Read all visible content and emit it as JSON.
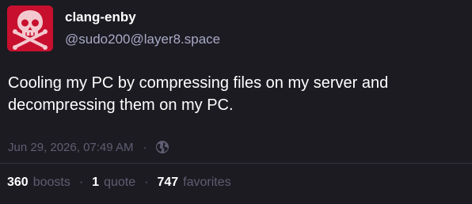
{
  "author": {
    "display_name": "clang-enby",
    "handle": "@sudo200@layer8.space",
    "avatar_icon": "skull-and-crossbones-icon",
    "avatar_color": "#c8102e"
  },
  "post": {
    "content": "Cooling my PC by compressing files on my server and decompressing them on my PC."
  },
  "meta": {
    "timestamp": "Jun 29, 2026, 07:49 AM",
    "separator": "·",
    "visibility_icon": "globe-icon"
  },
  "stats": {
    "boosts_count": "360",
    "boosts_label": "boosts",
    "quotes_count": "1",
    "quotes_label": "quote",
    "favorites_count": "747",
    "favorites_label": "favorites",
    "separator": "·"
  },
  "colors": {
    "background": "#1c1b22",
    "text": "#ffffff",
    "muted": "#5f5e72",
    "handle": "#a9a9c6"
  }
}
